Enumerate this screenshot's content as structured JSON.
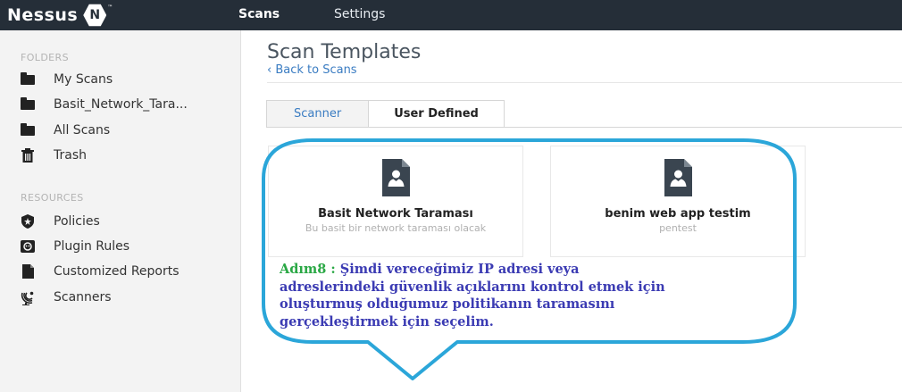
{
  "topbar": {
    "logo_text": "Nessus",
    "logo_badge": "N",
    "logo_tm": "™",
    "nav": [
      {
        "label": "Scans"
      },
      {
        "label": "Settings"
      }
    ]
  },
  "sidebar": {
    "folders_title": "FOLDERS",
    "folders": [
      {
        "label": "My Scans",
        "icon": "folder-icon"
      },
      {
        "label": "Basit_Network_Tara...",
        "icon": "folder-icon"
      },
      {
        "label": "All Scans",
        "icon": "folder-icon"
      },
      {
        "label": "Trash",
        "icon": "trash-icon"
      }
    ],
    "resources_title": "RESOURCES",
    "resources": [
      {
        "label": "Policies",
        "icon": "shield-icon"
      },
      {
        "label": "Plugin Rules",
        "icon": "plugin-rules-icon"
      },
      {
        "label": "Customized Reports",
        "icon": "report-icon"
      },
      {
        "label": "Scanners",
        "icon": "satellite-dish-icon"
      }
    ]
  },
  "main": {
    "page_title": "Scan Templates",
    "back_link": "‹ Back to Scans",
    "tabs": [
      {
        "label": "Scanner",
        "active": false
      },
      {
        "label": "User Defined",
        "active": true
      }
    ],
    "templates": [
      {
        "name": "Basit Network Taraması",
        "description": "Bu basit bir network taraması olacak",
        "icon": "user-document-icon"
      },
      {
        "name": "benim web app testim",
        "description": "pentest",
        "icon": "user-document-icon"
      }
    ]
  },
  "annotation": {
    "step_label": "Adım8 :",
    "lines": [
      "Şimdi vereceğimiz IP adresi veya",
      "adreslerindeki güvenlik açıklarını kontrol etmek için",
      "oluşturmuş olduğumuz politikanın taramasını",
      "gerçekleştirmek için seçelim."
    ]
  },
  "colors": {
    "topbar_bg": "#252e38",
    "link": "#3a7cc2",
    "callout_border": "#2ba6d9",
    "step_label": "#2aa845",
    "annotation_text": "#3b3bb3"
  }
}
